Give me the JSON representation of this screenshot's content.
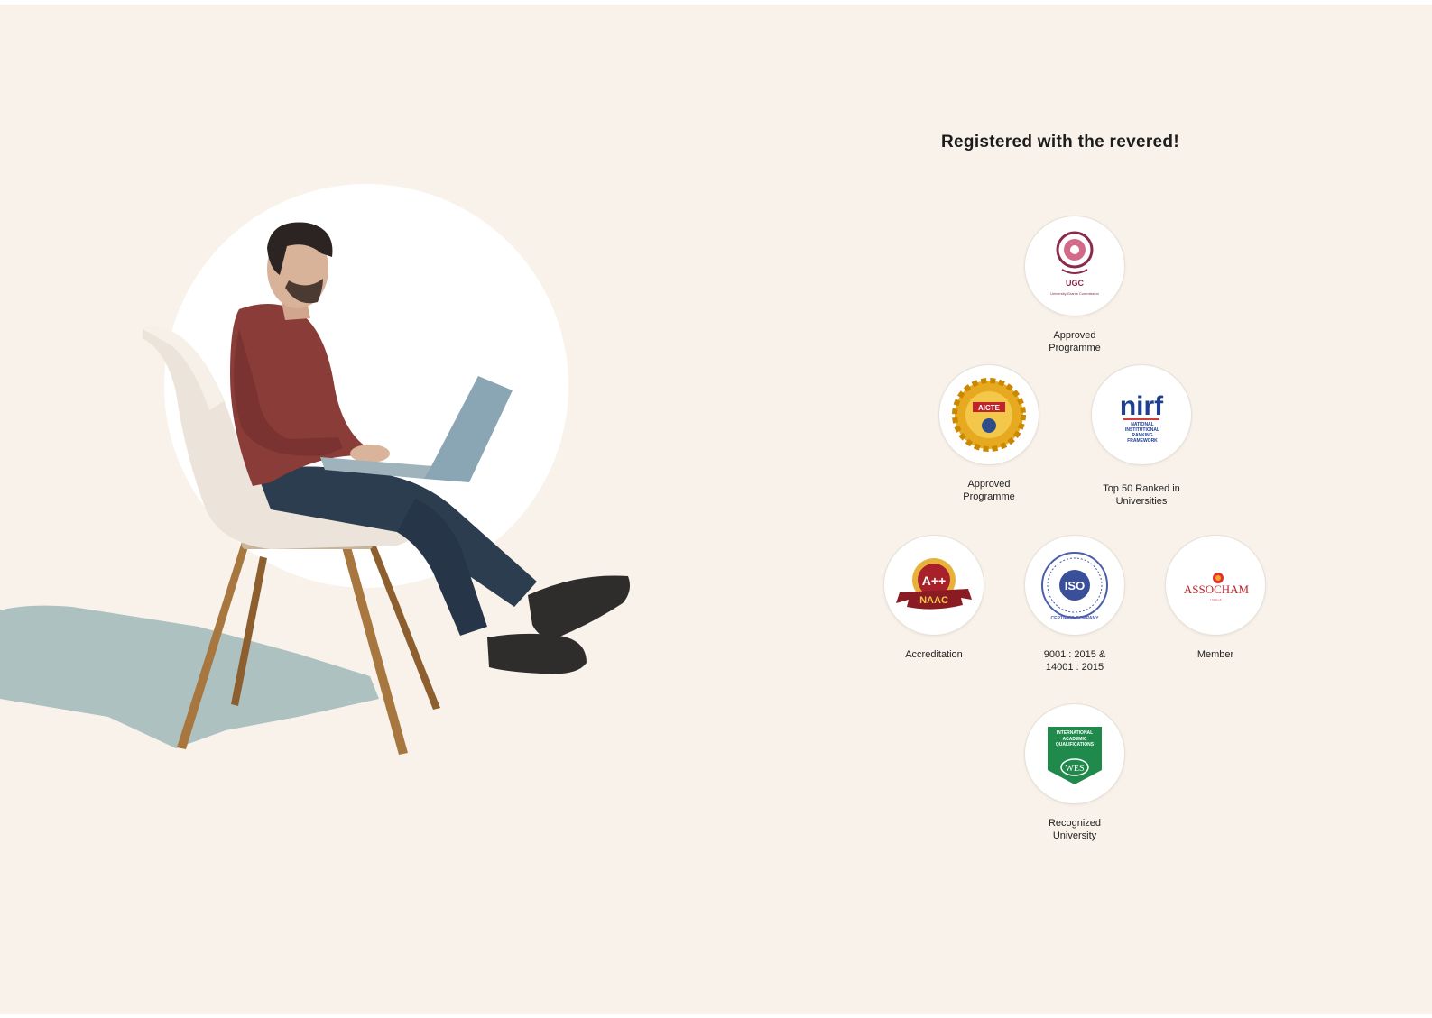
{
  "heading": "Registered with the revered!",
  "colors": {
    "background": "#f8f2ea",
    "shadow": "#9fb8b9",
    "text": "#1c1c1c"
  },
  "accreditations": [
    {
      "key": "ugc",
      "logo_text": "UGC",
      "logo_subtext": "University Grants Commission",
      "caption": "Approved\nProgramme"
    },
    {
      "key": "aicte",
      "logo_text": "AICTE",
      "caption": "Approved\nProgramme"
    },
    {
      "key": "nirf",
      "logo_text": "nirf",
      "logo_subtext": "NATIONAL INSTITUTIONAL RANKING FRAMEWORK",
      "caption": "Top 50 Ranked in\nUniversities"
    },
    {
      "key": "naac",
      "logo_text": "A++",
      "logo_subtext": "NAAC",
      "caption": "Accreditation"
    },
    {
      "key": "iso",
      "logo_text": "ISO",
      "logo_subtext": "CERTIFIED COMPANY",
      "caption": "9001 : 2015 &\n14001 : 2015"
    },
    {
      "key": "assocham",
      "logo_text": "ASSOCHAM",
      "logo_subtext": "INDIA",
      "caption": "Member"
    },
    {
      "key": "wes",
      "logo_text": "INTERNATIONAL ACADEMIC QUALIFICATIONS",
      "logo_subtext": "WES",
      "caption": "Recognized\nUniversity"
    }
  ]
}
